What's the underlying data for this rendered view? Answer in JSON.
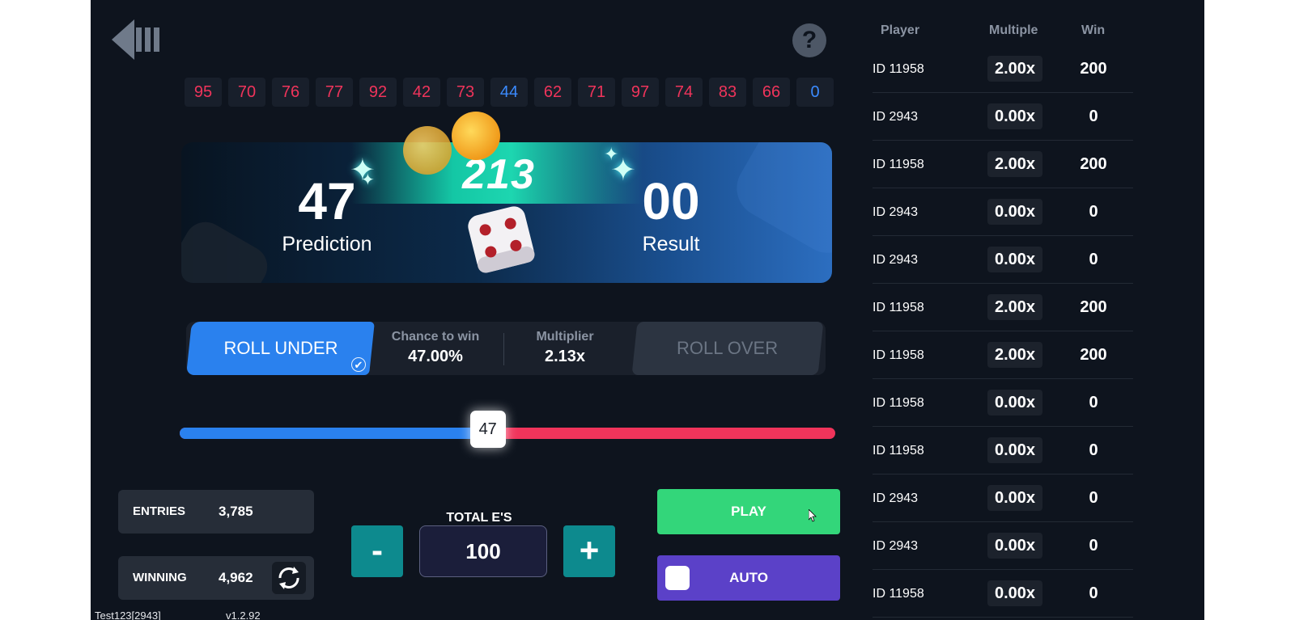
{
  "history": [
    {
      "value": "95",
      "color": "#f0345b"
    },
    {
      "value": "70",
      "color": "#f0345b"
    },
    {
      "value": "76",
      "color": "#f0345b"
    },
    {
      "value": "77",
      "color": "#f0345b"
    },
    {
      "value": "92",
      "color": "#f0345b"
    },
    {
      "value": "42",
      "color": "#f0345b"
    },
    {
      "value": "73",
      "color": "#f0345b"
    },
    {
      "value": "44",
      "color": "#3b8bff"
    },
    {
      "value": "62",
      "color": "#f0345b"
    },
    {
      "value": "71",
      "color": "#f0345b"
    },
    {
      "value": "97",
      "color": "#f0345b"
    },
    {
      "value": "74",
      "color": "#f0345b"
    },
    {
      "value": "83",
      "color": "#f0345b"
    },
    {
      "value": "66",
      "color": "#f0345b"
    },
    {
      "value": "0",
      "color": "#3b8bff"
    }
  ],
  "help_label": "?",
  "banner": {
    "jackpot": "213",
    "prediction": "47",
    "prediction_label": "Prediction",
    "result": "00",
    "result_label": "Result"
  },
  "controls": {
    "roll_under_label": "ROLL UNDER",
    "roll_over_label": "ROLL OVER",
    "chance_label": "Chance to win",
    "chance_value": "47.00%",
    "multiplier_label": "Multiplier",
    "multiplier_value": "2.13x",
    "mode": "roll_under"
  },
  "slider": {
    "value": "47",
    "min": 0,
    "max": 100,
    "under_color": "#2a81ee",
    "over_color": "#f0345b"
  },
  "stats": {
    "entries_label": "ENTRIES",
    "entries_value": "3,785",
    "winning_label": "WINNING",
    "winning_value": "4,962"
  },
  "bet": {
    "minus_label": "-",
    "plus_label": "+",
    "total_label": "TOTAL E'S",
    "total_value": "100"
  },
  "actions": {
    "play_label": "PLAY",
    "auto_label": "AUTO",
    "play_color": "#33d67a",
    "auto_color": "#5b41c8"
  },
  "footer": {
    "user": "Test123[2943]",
    "version": "v1.2.92"
  },
  "leaderboard": {
    "headers": {
      "player": "Player",
      "multiple": "Multiple",
      "win": "Win"
    },
    "rows": [
      {
        "player": "ID 11958",
        "multiple": "2.00x",
        "win": "200"
      },
      {
        "player": "ID 2943",
        "multiple": "0.00x",
        "win": "0"
      },
      {
        "player": "ID 11958",
        "multiple": "2.00x",
        "win": "200"
      },
      {
        "player": "ID 2943",
        "multiple": "0.00x",
        "win": "0"
      },
      {
        "player": "ID 2943",
        "multiple": "0.00x",
        "win": "0"
      },
      {
        "player": "ID 11958",
        "multiple": "2.00x",
        "win": "200"
      },
      {
        "player": "ID 11958",
        "multiple": "2.00x",
        "win": "200"
      },
      {
        "player": "ID 11958",
        "multiple": "0.00x",
        "win": "0"
      },
      {
        "player": "ID 11958",
        "multiple": "0.00x",
        "win": "0"
      },
      {
        "player": "ID 2943",
        "multiple": "0.00x",
        "win": "0"
      },
      {
        "player": "ID 2943",
        "multiple": "0.00x",
        "win": "0"
      },
      {
        "player": "ID 11958",
        "multiple": "0.00x",
        "win": "0"
      }
    ]
  }
}
